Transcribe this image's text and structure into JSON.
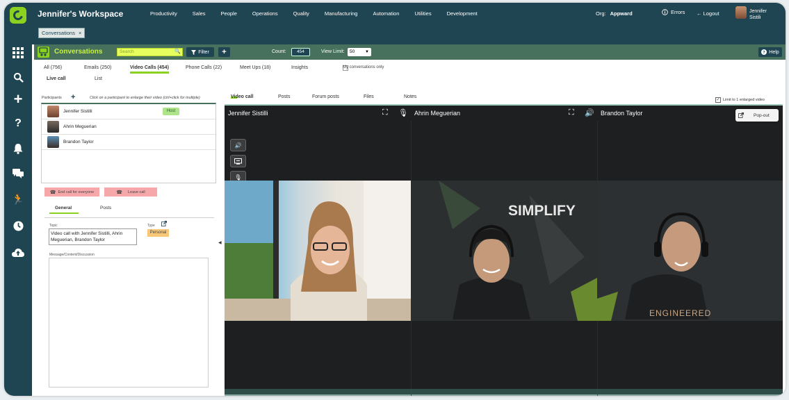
{
  "topbar": {
    "workspace": "Jennifer's Workspace",
    "nav": [
      "Productivity",
      "Sales",
      "People",
      "Operations",
      "Quality",
      "Manufacturing",
      "Automation",
      "Utilities",
      "Development"
    ],
    "org_label": "Org:",
    "org_value": "Appward",
    "errors": "Errors",
    "logout": "Logout",
    "user_first": "Jennifer",
    "user_last": "Sistili"
  },
  "chip": {
    "label": "Conversations"
  },
  "module": {
    "title": "Conversations",
    "search_placeholder": "Search",
    "filter": "Filter",
    "count_label": "Count:",
    "count_value": "454",
    "view_limit_label": "View Limit:",
    "view_limit_value": "50",
    "help": "Help"
  },
  "tabs": {
    "primary": [
      "All (756)",
      "Emails (250)",
      "Video Calls (454)",
      "Phone Calls (22)",
      "Meet Ups (18)",
      "Insights"
    ],
    "mine_only": "My conversations only",
    "secondary": [
      "Live call",
      "List"
    ]
  },
  "participants": {
    "label": "Participants",
    "hint": "Click on a participant to enlarge their video (ctrl+click for multiple)",
    "list": [
      {
        "name": "Jennifer Sistilli",
        "badge": "Host"
      },
      {
        "name": "Ahrin Meguerian",
        "badge": ""
      },
      {
        "name": "Brandon Taylor",
        "badge": ""
      }
    ],
    "end_call": "End call for everyone",
    "leave_call": "Leave call"
  },
  "details": {
    "tabs": [
      "General",
      "Posts"
    ],
    "topic_label": "Topic",
    "topic_value": "Video call with Jennifer Sistilli, Ahrin Meguerian, Brandon Taylor",
    "type_label": "Type",
    "type_value": "Personal",
    "message_label": "Message/Content/Discussion"
  },
  "call": {
    "tabs": [
      "Video call",
      "Posts",
      "Forum posts",
      "Files",
      "Notes"
    ],
    "limit_label": "Limit to 1 enlarged video",
    "popout": "Pop-out",
    "tiles": [
      {
        "name": "Jennifer Sistilli"
      },
      {
        "name": "Ahrin Meguerian"
      },
      {
        "name": "Brandon Taylor"
      }
    ],
    "wall_text": "SIMPLIFY",
    "shirt_text": "ENGINEERED"
  },
  "colors": {
    "navy": "#1f4452",
    "green_bar": "#47715c",
    "accent": "#8bd11f",
    "search_bg": "#e7ff5e",
    "danger_btn": "#f5a7a9",
    "host_badge": "#aee58a",
    "type_badge": "#f8c878"
  }
}
